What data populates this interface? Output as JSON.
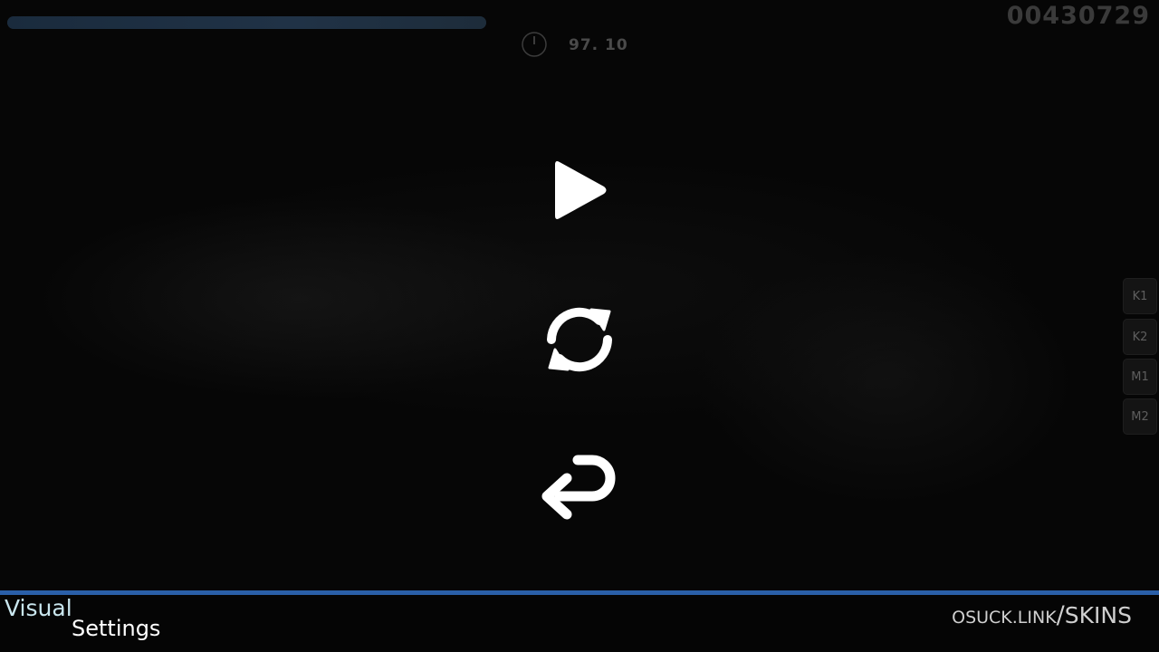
{
  "hud": {
    "score": "00430729",
    "accuracy": "97. 10",
    "song_progress": 0.4125,
    "colors": {
      "progress_fill": "#203246",
      "accent_line": "#2a5fa8"
    }
  },
  "pause_menu": {
    "continue_icon": "play-icon",
    "retry_icon": "retry-icon",
    "back_icon": "back-arrow-icon"
  },
  "key_overlay": {
    "keys": [
      "K1",
      "K2",
      "M1",
      "M2"
    ]
  },
  "footer": {
    "visual": "Visual",
    "settings": "Settings",
    "watermark_domain": "OSUCK.LINK",
    "watermark_slash": "/",
    "watermark_path": "SKINS"
  }
}
